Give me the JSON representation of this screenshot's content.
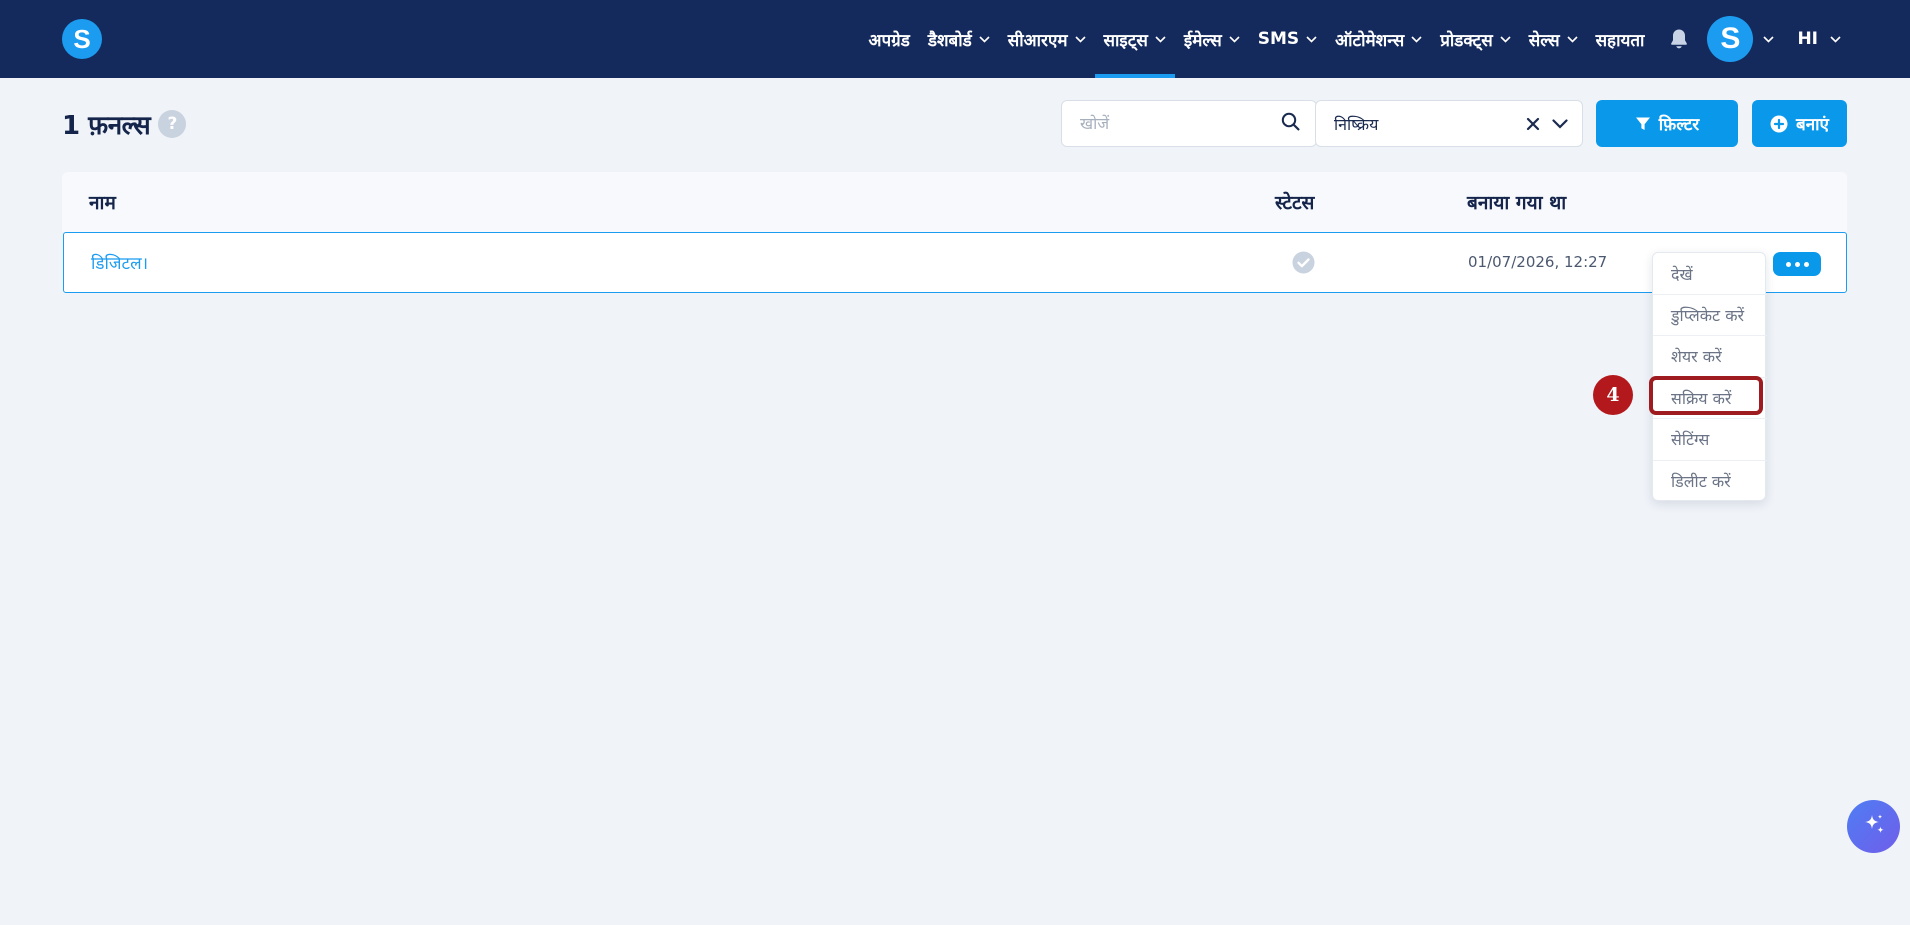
{
  "navbar": {
    "logo_letter": "S",
    "items": [
      {
        "label": "अपग्रेड",
        "has_dropdown": false
      },
      {
        "label": "डैशबोर्ड",
        "has_dropdown": true
      },
      {
        "label": "सीआरएम",
        "has_dropdown": true
      },
      {
        "label": "साइट्स",
        "has_dropdown": true,
        "active": true
      },
      {
        "label": "ईमेल्स",
        "has_dropdown": true
      },
      {
        "label": "SMS",
        "has_dropdown": true
      },
      {
        "label": "ऑटोमेशन्स",
        "has_dropdown": true
      },
      {
        "label": "प्रोडक्ट्स",
        "has_dropdown": true
      },
      {
        "label": "सेल्स",
        "has_dropdown": true
      },
      {
        "label": "सहायता",
        "has_dropdown": false
      }
    ],
    "notification_icon": "bell-icon",
    "avatar_letter": "S",
    "language": "HI",
    "accent_color": "#1c9cf0",
    "background_color": "#152a5c"
  },
  "toolbar": {
    "title": "1 फ़नल्स",
    "help_label": "?",
    "search_placeholder": "खोजें",
    "status_filter_value": "निष्क्रिय",
    "filter_button_label": "फ़िल्टर",
    "create_button_label": "बनाएं"
  },
  "table": {
    "columns": [
      "नाम",
      "स्टेटस",
      "बनाया गया था"
    ],
    "rows": [
      {
        "name": "डिजिटल।",
        "status_icon": "check-circle-icon",
        "created": "01/07/2026, 12:27"
      }
    ]
  },
  "row_menu": {
    "items": [
      "देखें",
      "डुप्लिकेट करें",
      "शेयर करें",
      "सक्रिय करें",
      "सेटिंग्स",
      "डिलीट करें"
    ],
    "highlighted_index": 3
  },
  "annotation": {
    "step_number": "4",
    "color": "#b3191c"
  },
  "fab": {
    "icon": "sparkle-icon"
  }
}
